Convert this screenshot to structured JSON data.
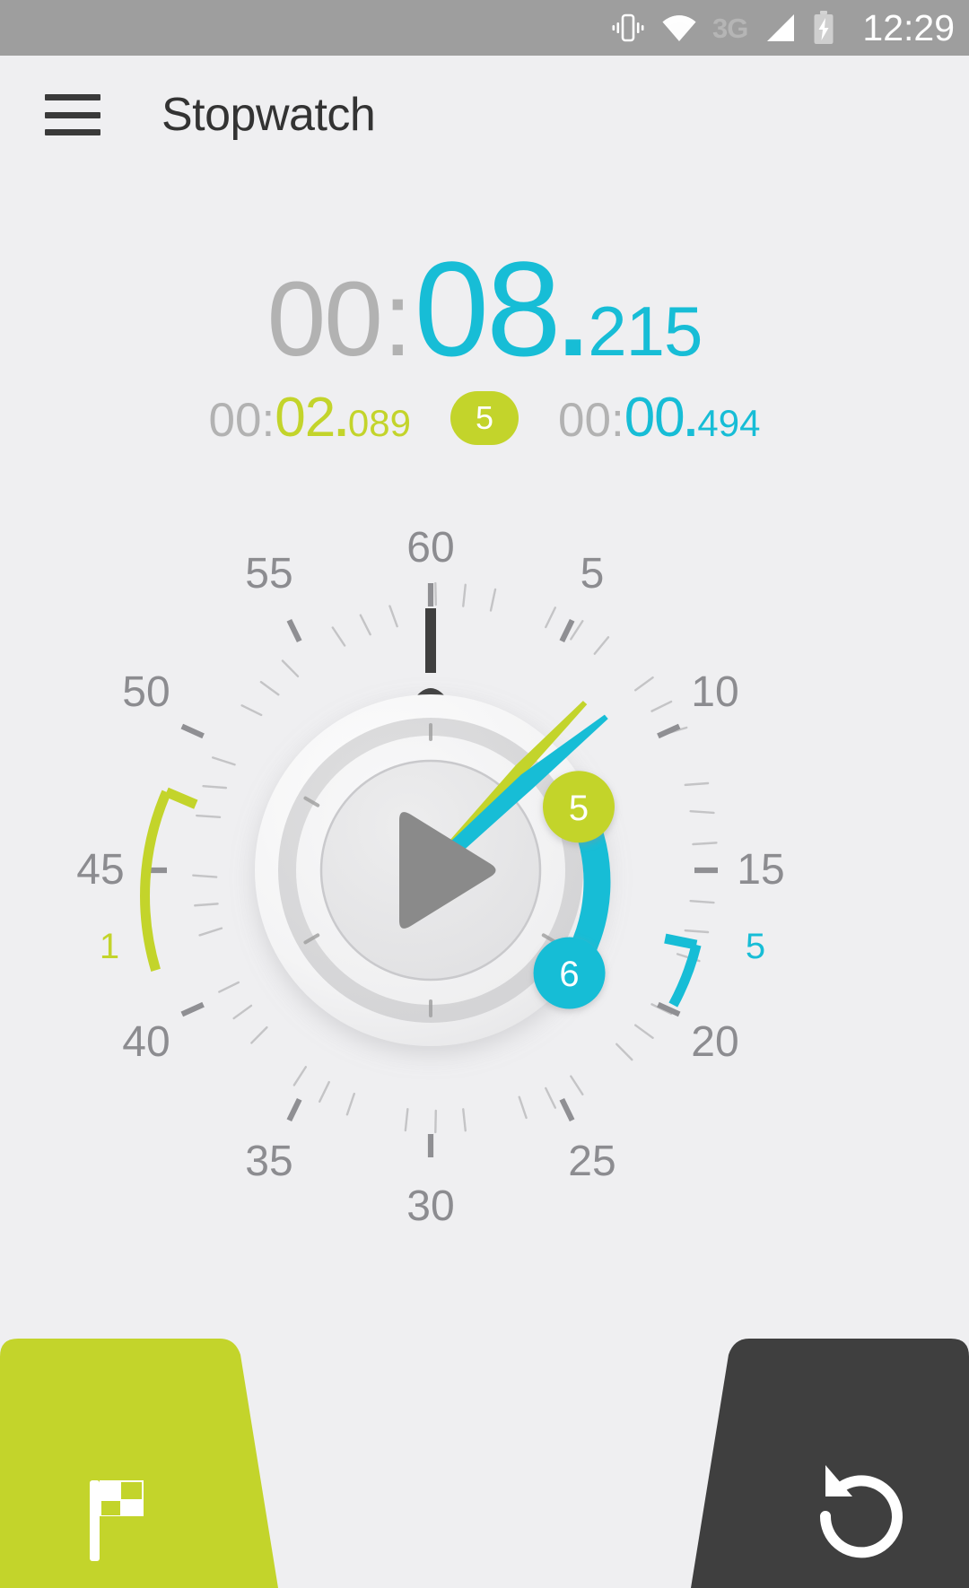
{
  "status_bar": {
    "icons": [
      "vibrate-icon",
      "wifi-icon",
      "signal-icon",
      "battery-charging-icon"
    ],
    "network_label": "3G",
    "clock": "12:29",
    "background_color": "#9E9E9E"
  },
  "app_bar": {
    "menu_icon": "hamburger-menu-icon",
    "title": "Stopwatch"
  },
  "colors": {
    "accent_cyan": "#17BDD6",
    "accent_lime": "#C3D42B",
    "dim_gray": "#B2B2B2",
    "dark": "#3F3F3F",
    "background": "#EFEFF1"
  },
  "main_timer": {
    "hours_minutes": "00",
    "separator": ":",
    "seconds": "08",
    "decimal": ".",
    "milliseconds": "215",
    "full": "00:08.215"
  },
  "laps": {
    "best_lap": {
      "prefix": "00",
      "separator": ":",
      "seconds": "02",
      "decimal": ".",
      "milliseconds": "089",
      "full": "00:02.089",
      "color": "#C3D42B"
    },
    "lap_count_badge": "5",
    "current_lap": {
      "prefix": "00",
      "separator": ":",
      "seconds": "00",
      "decimal": ".",
      "milliseconds": "494",
      "full": "00:00.494",
      "color": "#17BDD6"
    }
  },
  "dial": {
    "tick_labels": [
      "60",
      "5",
      "10",
      "15",
      "20",
      "25",
      "30",
      "35",
      "40",
      "45",
      "50",
      "55"
    ],
    "major_tick_values": [
      0,
      5,
      10,
      15,
      20,
      25,
      30,
      35,
      40,
      45,
      50,
      55
    ],
    "total_seconds": 60,
    "hand_positions": {
      "cyan_hand_seconds": 8.215,
      "lime_hand_seconds": 7.2,
      "black_pointer_seconds": 0
    },
    "progress_arc": {
      "color": "#17BDD6",
      "start_seconds": 6.5,
      "end_seconds": 14.5
    },
    "marker_badges": [
      {
        "label": "5",
        "color": "#C3D42B",
        "text_color": "#FFFFFF",
        "seconds": 6.5
      },
      {
        "label": "6",
        "color": "#17BDD6",
        "text_color": "#FFFFFF",
        "seconds": 14.5
      }
    ],
    "outer_markers": [
      {
        "label": "1",
        "color": "#C3D42B",
        "start_seconds": 41.0,
        "end_seconds": 47.2,
        "label_seconds": 43.8
      },
      {
        "label": "5",
        "color": "#17BDD6",
        "start_seconds": 16.8,
        "end_seconds": 20.2,
        "label_seconds": 18.4
      }
    ],
    "center_button": {
      "icon": "play-icon",
      "label": "Start",
      "color": "#8A8A8A"
    }
  },
  "actions": {
    "lap_button": {
      "icon": "flag-icon",
      "label": "Lap",
      "background": "#C3D42B"
    },
    "reset_button": {
      "icon": "reset-icon",
      "label": "Reset",
      "background": "#3F3F3F"
    }
  }
}
